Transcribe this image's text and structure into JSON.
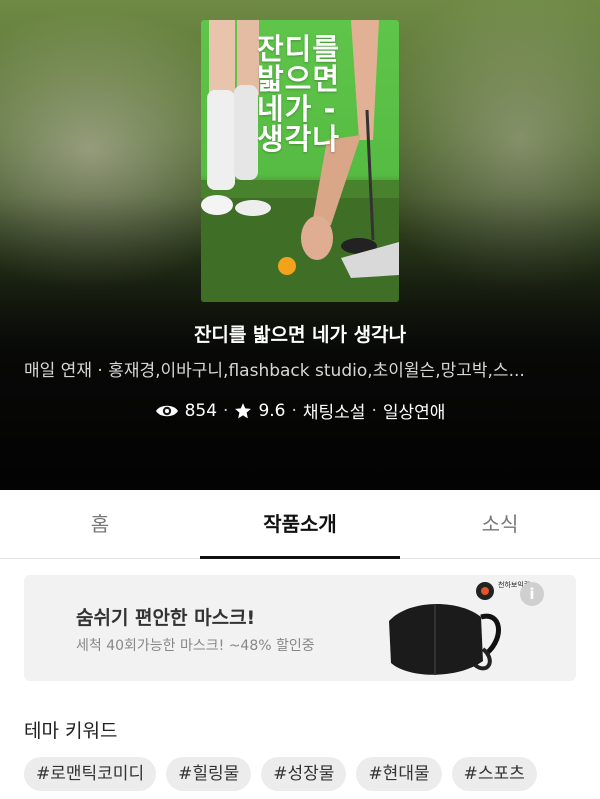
{
  "hero": {
    "cover_title": "잔디를\n밟으면\n네가 -\n생각나",
    "title": "잔디를 밟으면 네가 생각나",
    "meta": "매일 연재 · 홍재경,이바구니,flashback studio,초이윌슨,망고박,스...",
    "stats": {
      "views": "854",
      "rating": "9.6",
      "genre1": "채팅소설",
      "genre2": "일상연애",
      "separator": "·"
    }
  },
  "tabs": [
    {
      "label": "홈"
    },
    {
      "label": "작품소개"
    },
    {
      "label": "소식"
    }
  ],
  "ad": {
    "title": "숨쉬기 편안한 마스크!",
    "subtitle": "세척 40회가능한 마스크! ~48% 할인중",
    "brand": "천하보익컨",
    "info_glyph": "i"
  },
  "keywords": {
    "heading": "테마 키워드",
    "items": [
      "#로맨틱코미디",
      "#힐링물",
      "#성장물",
      "#현대물",
      "#스포츠"
    ]
  },
  "colors": {
    "tab_active": "#111111",
    "chip_bg": "#ececec",
    "ad_bg": "#f2f2f2",
    "cover_green": "#5fc54a"
  }
}
